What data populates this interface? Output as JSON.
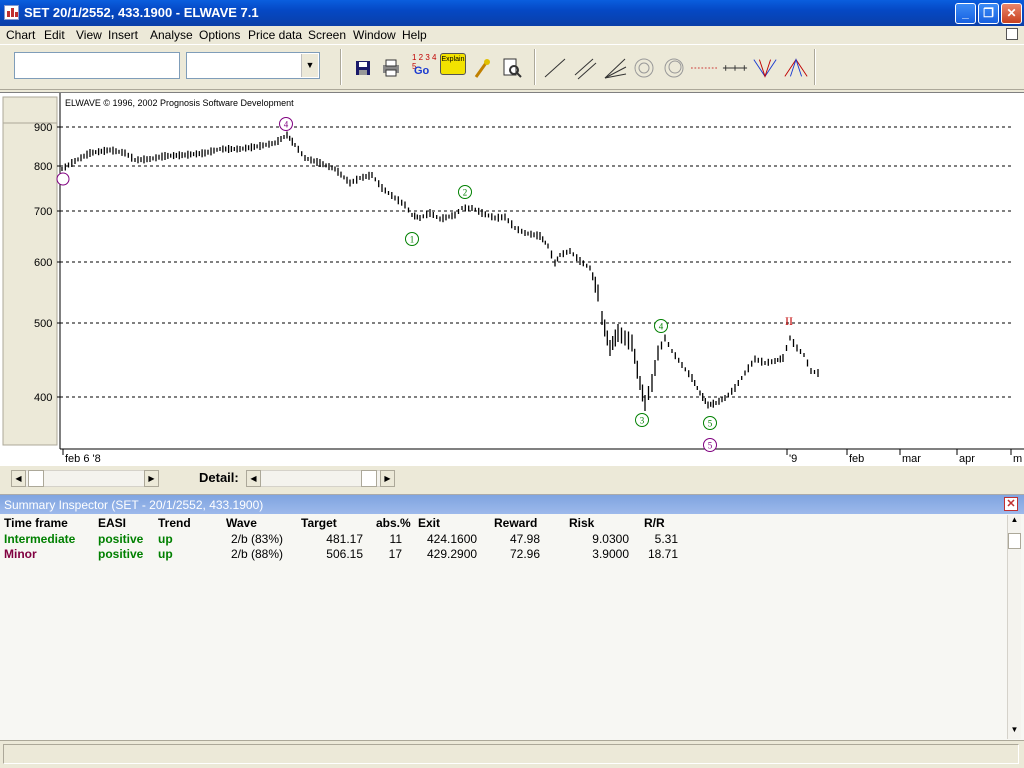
{
  "window": {
    "title": "SET  20/1/2552, 433.1900 - ELWAVE 7.1"
  },
  "menu": [
    "Chart",
    "Edit",
    "View",
    "Insert",
    "Analyse",
    "Options",
    "Price data",
    "Screen",
    "Window",
    "Help"
  ],
  "toolbar": {
    "search_value": "",
    "combo_value": "",
    "explain_label": "Explain",
    "goto_label": "Go",
    "goto_digits": "1 2 3 4 5"
  },
  "chart": {
    "copyright": "ELWAVE © 1996, 2002 Prognosis Software Development",
    "y_ticks": [
      "900",
      "800",
      "700",
      "600",
      "500",
      "400"
    ],
    "x_ticks": [
      "feb 6 '8",
      "'9",
      "feb",
      "mar",
      "apr",
      "m"
    ],
    "wave_labels": {
      "green": [
        "1",
        "2",
        "3",
        "4",
        "5"
      ],
      "purple": [
        "4",
        "5"
      ],
      "red": [
        "II"
      ]
    },
    "colors": {
      "green": "#008000",
      "purple": "#800080",
      "red": "#c00000"
    }
  },
  "detail_label": "Detail:",
  "inspector": {
    "title": "Summary Inspector (SET - 20/1/2552, 433.1900)",
    "headers": [
      "Time frame",
      "EASI",
      "Trend",
      "Wave",
      "Target",
      "abs.%",
      "Exit",
      "Reward",
      "Risk",
      "R/R"
    ],
    "rows": [
      {
        "timeframe": "Intermediate",
        "easi": "positive",
        "trend": "up",
        "wave": "2/b (83%)",
        "target": "481.17",
        "abs": "11",
        "exit": "424.1600",
        "reward": "47.98",
        "risk": "9.0300",
        "rr": "5.31"
      },
      {
        "timeframe": "Minor",
        "easi": "positive",
        "trend": "up",
        "wave": "2/b (88%)",
        "target": "506.15",
        "abs": "17",
        "exit": "429.2900",
        "reward": "72.96",
        "risk": "3.9000",
        "rr": "18.71"
      }
    ],
    "colors": {
      "intermediate": "#008000",
      "minor": "#800040",
      "positive": "#008000"
    }
  }
}
